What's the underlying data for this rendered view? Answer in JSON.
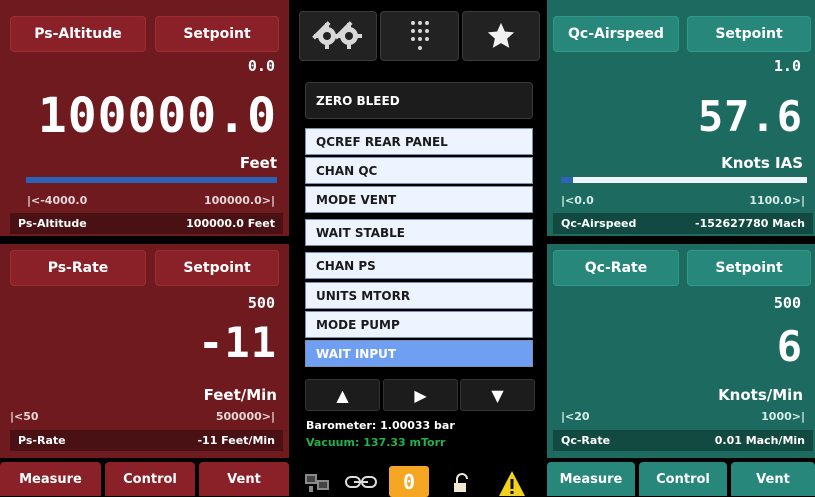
{
  "left_top": {
    "title": "Ps-Altitude",
    "setpoint_label": "Setpoint",
    "setpoint_value": "0.0",
    "reading": "100000.0",
    "unit": "Feet",
    "range_low": "|<-4000.0",
    "range_high": "100000.0>|",
    "bar_fill": 1.0,
    "footer_label": "Ps-Altitude",
    "footer_value": "100000.0 Feet"
  },
  "left_bottom": {
    "title": "Ps-Rate",
    "setpoint_label": "Setpoint",
    "setpoint_value": "500",
    "reading": "-11",
    "unit": "Feet/Min",
    "range_low": "|<50",
    "range_high": "500000>|",
    "footer_label": "Ps-Rate",
    "footer_value": "-11 Feet/Min"
  },
  "right_top": {
    "title": "Qc-Airspeed",
    "setpoint_label": "Setpoint",
    "setpoint_value": "1.0",
    "reading": "57.6",
    "unit": "Knots IAS",
    "range_low": "|<0.0",
    "range_high": "1100.0>|",
    "bar_fill": 0.05,
    "footer_label": "Qc-Airspeed",
    "footer_value": "-152627780 Mach"
  },
  "right_bottom": {
    "title": "Qc-Rate",
    "setpoint_label": "Setpoint",
    "setpoint_value": "500",
    "reading": "6",
    "unit": "Knots/Min",
    "range_low": "|<20",
    "range_high": "1000>|",
    "footer_label": "Qc-Rate",
    "footer_value": "0.01 Mach/Min"
  },
  "center": {
    "icons": [
      "gears-icon",
      "keypad-icon",
      "star-icon"
    ],
    "zero_bleed_label": "ZERO BLEED",
    "menu_items": [
      "QCREF REAR PANEL",
      "CHAN QC",
      "MODE VENT",
      "WAIT STABLE",
      "CHAN PS",
      "UNITS MTORR",
      "MODE PUMP",
      "WAIT INPUT"
    ],
    "active_index": 7,
    "arrow_buttons": [
      "▲",
      "▶",
      "▼"
    ],
    "barometer_label": "Barometer:",
    "barometer_value": "1.00033 bar",
    "vacuum_label": "Vacuum:",
    "vacuum_value": "137.33 mTorr",
    "status_badge": "0"
  },
  "bottom_left": {
    "measure": "Measure",
    "control": "Control",
    "vent": "Vent"
  },
  "bottom_right": {
    "measure": "Measure",
    "control": "Control",
    "vent": "Vent"
  },
  "colors": {
    "panel_red": "#6e1a1e",
    "panel_teal": "#1d6b60",
    "menu_active": "#6f9ff3",
    "vacuum_green": "#22b14c",
    "status_orange": "#f5a623",
    "warning_yellow": "#f2d21b"
  }
}
